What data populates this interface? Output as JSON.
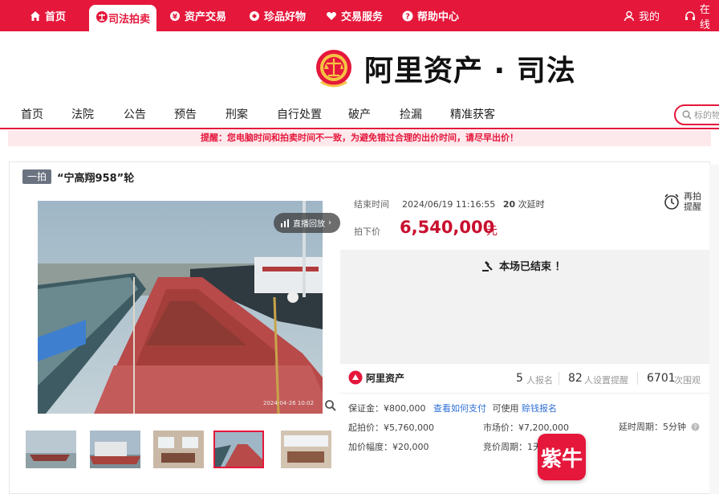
{
  "topnav": {
    "home": "首页",
    "judicial": "司法拍卖",
    "asset_trade": "资产交易",
    "treasures": "珍品好物",
    "trade_service": "交易服务",
    "help": "帮助中心",
    "me": "我的",
    "online": "在线"
  },
  "logo": {
    "text": "阿里资产 · 司法"
  },
  "catnav": [
    "首页",
    "法院",
    "公告",
    "预告",
    "刑案",
    "自行处置",
    "破产",
    "捡漏",
    "精准获客"
  ],
  "search": {
    "placeholder": "标的物"
  },
  "notice": "提醒：您电脑时间和拍卖时间不一致，为避免错过合理的出价时间，请尽早出价！",
  "lot": {
    "badge": "一拍",
    "title": "“宁高翔958”轮"
  },
  "media": {
    "replay_label": "直播回放",
    "timestamp": "2024-04-26 10:02"
  },
  "auction": {
    "end_label": "结束时间",
    "end_time": "2024/06/19 11:16:55",
    "delay_count": "20",
    "delay_label": "次延时",
    "price_label": "拍下价",
    "price": "6,540,000",
    "price_unit": "元",
    "remind_line1": "再拍",
    "remind_line2": "提醒",
    "ended_text": "本场已结束 ！"
  },
  "stats": {
    "brand": "阿里资产",
    "signups": "5",
    "signups_label": "人报名",
    "reminders": "82",
    "reminders_label": "人设置提醒",
    "views": "6701",
    "views_label": "次围观"
  },
  "details": {
    "deposit": "保证金：¥800,000",
    "deposit_link": "查看如何支付",
    "deposit_usable": "可使用",
    "deposit_credit": "赊钱报名",
    "start_price": "起拍价：¥5,760,000",
    "market_price": "市场价：¥7,200,000",
    "delay_period": "延时周期：5分钟",
    "increment": "加价幅度：¥20,000",
    "bid_period": "竞价周期：1天"
  },
  "watermark": {
    "text": "紫牛"
  },
  "colors": {
    "accent": "#e5173b",
    "price": "#c8102e",
    "link": "#2f6fd6"
  }
}
